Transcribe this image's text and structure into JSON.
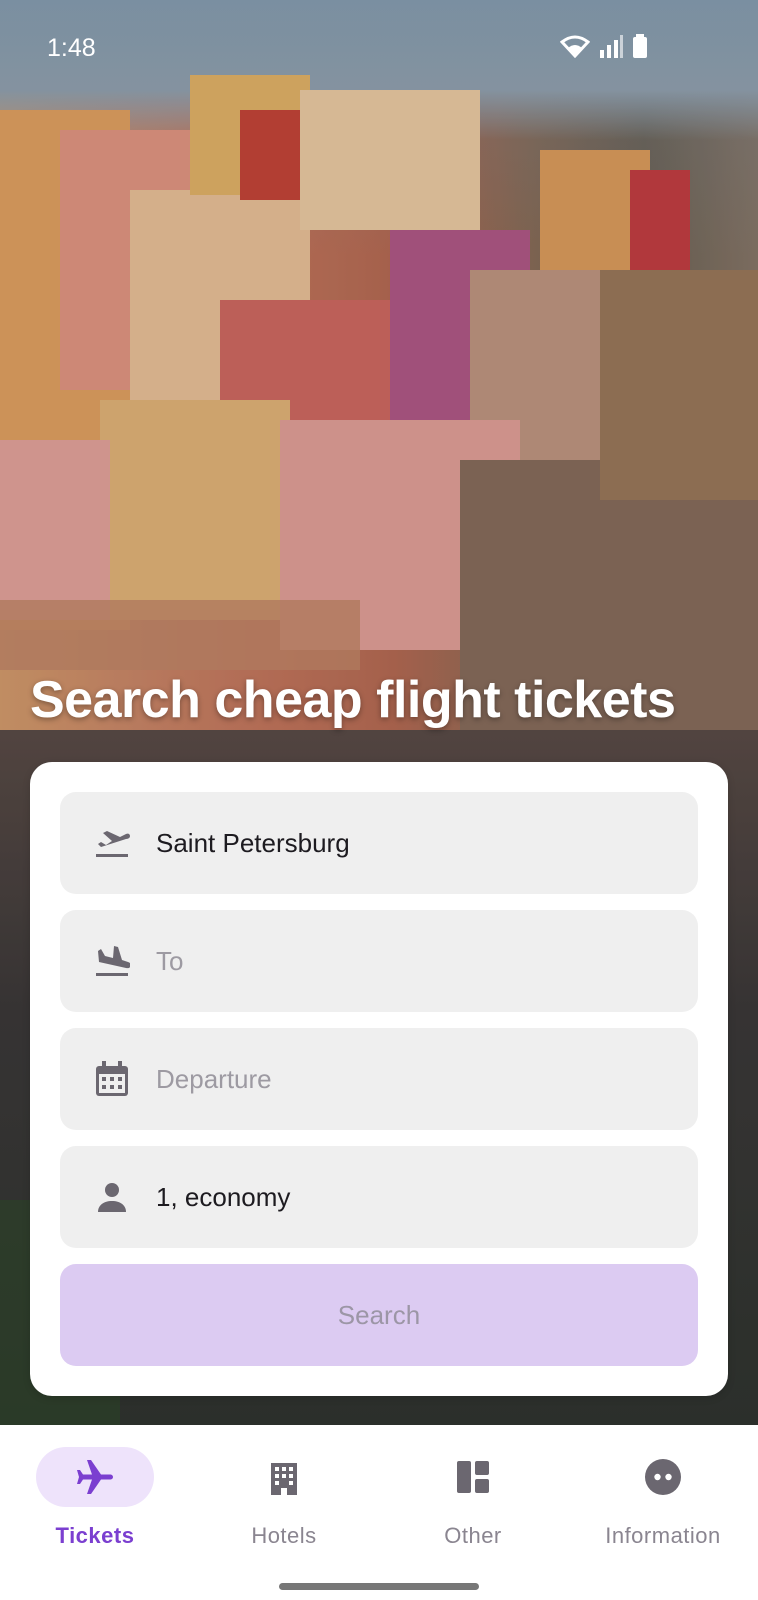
{
  "status_bar": {
    "time": "1:48"
  },
  "hero": {
    "title": "Search cheap flight tickets"
  },
  "form": {
    "from": {
      "value": "Saint Petersburg",
      "icon": "flight-takeoff-icon"
    },
    "to": {
      "placeholder": "To",
      "icon": "flight-land-icon"
    },
    "departure": {
      "placeholder": "Departure",
      "icon": "calendar-icon"
    },
    "passengers": {
      "value": "1, economy",
      "icon": "person-icon"
    },
    "search_label": "Search"
  },
  "bottom_nav": {
    "items": [
      {
        "label": "Tickets",
        "icon": "airplane-icon",
        "active": true
      },
      {
        "label": "Hotels",
        "icon": "building-icon",
        "active": false
      },
      {
        "label": "Other",
        "icon": "dashboard-icon",
        "active": false
      },
      {
        "label": "Information",
        "icon": "info-face-icon",
        "active": false
      }
    ]
  },
  "colors": {
    "accent": "#7b3fd0",
    "accent_container": "#eee3fb",
    "search_button_bg": "#dccbf2",
    "field_bg": "#efefef"
  }
}
